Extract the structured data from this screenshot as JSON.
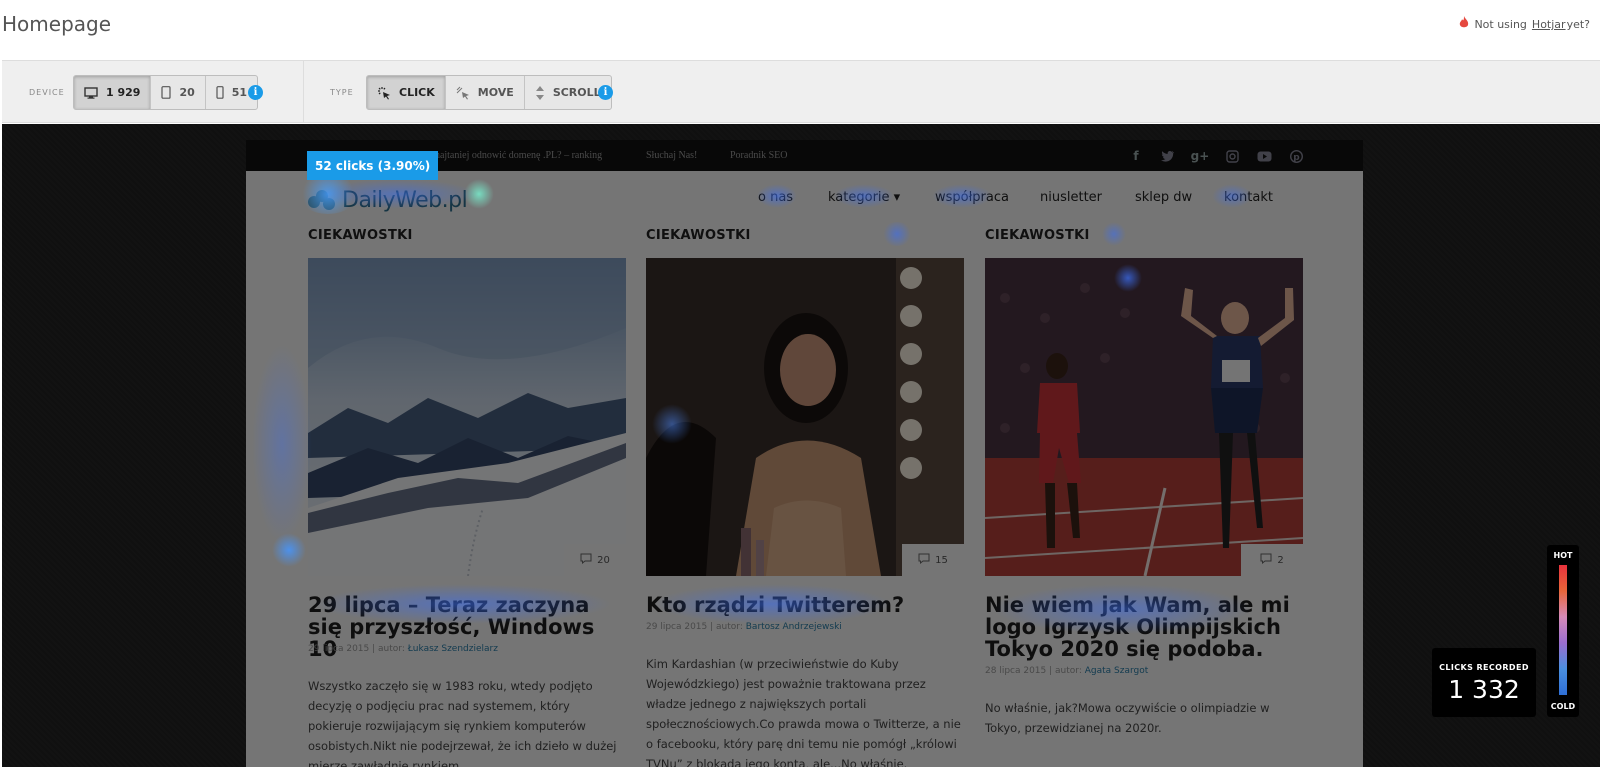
{
  "header": {
    "title": "Homepage",
    "hotjar_prefix": "Not using",
    "hotjar_link": "Hotjar",
    "hotjar_suffix": "yet?"
  },
  "toolbar": {
    "device_label": "DEVICE",
    "devices": [
      {
        "icon": "desktop-icon",
        "count": "1 929",
        "active": true
      },
      {
        "icon": "tablet-icon",
        "count": "20",
        "active": false
      },
      {
        "icon": "phone-icon",
        "count": "51",
        "active": false
      }
    ],
    "type_label": "TYPE",
    "types": [
      {
        "icon": "click-icon",
        "label": "CLICK",
        "active": true
      },
      {
        "icon": "move-icon",
        "label": "MOVE",
        "active": false
      },
      {
        "icon": "scroll-icon",
        "label": "SCROLL",
        "active": false
      }
    ]
  },
  "site": {
    "topbar_links": [
      "…e najtaniej odnowić domenę .PL? – ranking",
      "Słuchaj Nas!",
      "Poradnik SEO"
    ],
    "social_icons": [
      "facebook-icon",
      "twitter-icon",
      "google-plus-icon",
      "instagram-icon",
      "youtube-icon",
      "pinterest-icon"
    ],
    "logo_text": "DailyWeb.pl",
    "nav": [
      "o nas",
      "kategorie ▾",
      "współpraca",
      "niusletter",
      "sklep dw",
      "kontakt"
    ],
    "posts": [
      {
        "category": "CIEKAWOSTKI",
        "comments": "20",
        "title": "29 lipca – Teraz zaczyna się przyszłość, Windows 10",
        "date": "29 lipca 2015",
        "author_prefix": "autor:",
        "author": "Łukasz Szendzielarz",
        "excerpt": "Wszystko zaczęło się w 1983 roku, wtedy podjęto decyzję o podjęciu prac nad systemem, który pokieruje rozwijającym się rynkiem komputerów osobistych.Nikt nie podejrzewał, że ich dzieło w dużej mierze zawładnie rynkiem"
      },
      {
        "category": "CIEKAWOSTKI",
        "comments": "15",
        "title": "Kto rządzi Twitterem?",
        "date": "29 lipca 2015",
        "author_prefix": "autor:",
        "author": "Bartosz Andrzejewski",
        "excerpt": "Kim Kardashian (w przeciwieństwie do Kuby Wojewódzkiego) jest poważnie traktowana przez władze jednego z największych portali społecznościowych.Co prawda mowa o Twitterze, a nie o facebooku, który parę dni temu nie pomógł „królowi TVNu” z blokadą jego konta, ale...No właśnie."
      },
      {
        "category": "CIEKAWOSTKI",
        "comments": "2",
        "title": "Nie wiem jak Wam, ale mi logo Igrzysk Olimpijskich Tokyo 2020 się podoba.",
        "date": "28 lipca 2015",
        "author_prefix": "autor:",
        "author": "Agata Szargot",
        "excerpt": "No właśnie, jak?Mowa oczywiście o olimpiadzie w Tokyo, przewidzianej na 2020r."
      }
    ]
  },
  "tooltip": "52 clicks (3.90%)",
  "legend": {
    "clicks_label": "CLICKS RECORDED",
    "clicks_value": "1 332",
    "hot": "HOT",
    "cold": "COLD"
  },
  "colors": {
    "accent": "#1a9be8",
    "link": "#2b7ea8"
  }
}
